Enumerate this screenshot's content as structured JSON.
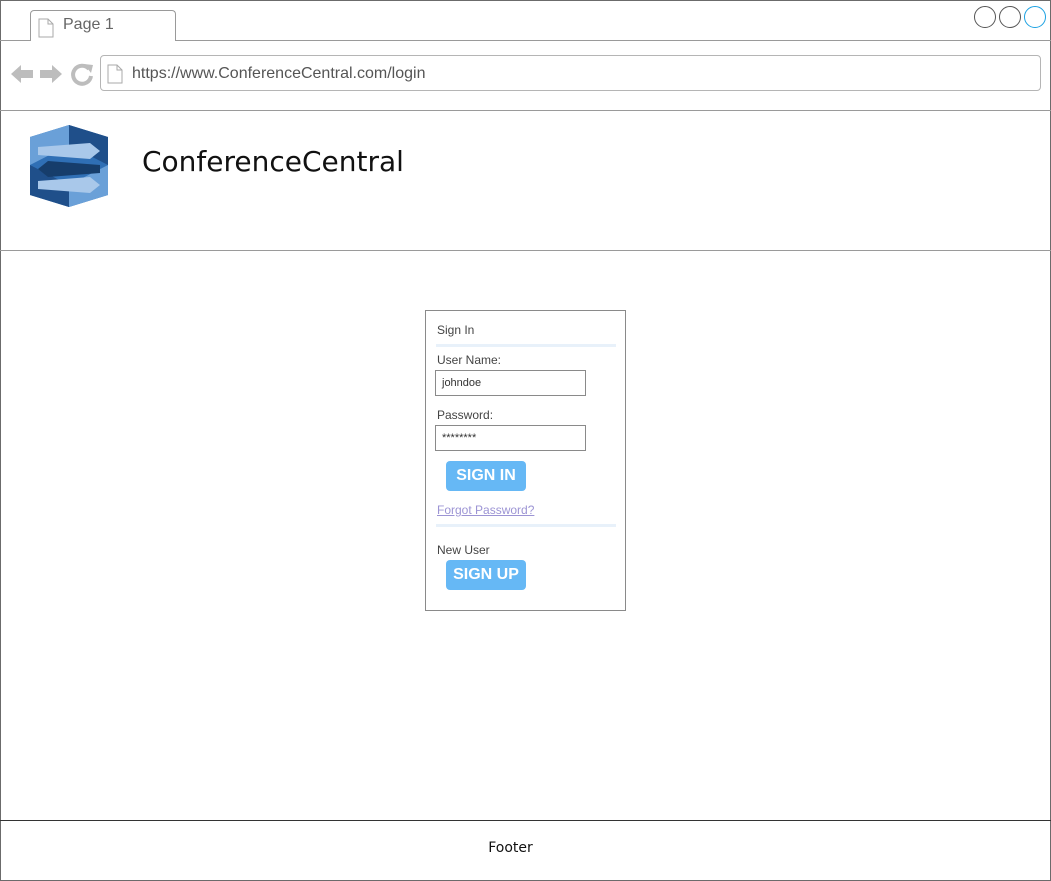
{
  "browser": {
    "tab_label": "Page 1",
    "url": "https://www.ConferenceCentral.com/login"
  },
  "header": {
    "site_title": "ConferenceCentral",
    "logo_icon": "hexagon-arrows-logo",
    "logo_colors": [
      "#1f4f8a",
      "#2f6fb5",
      "#6aa0d8",
      "#a9c8ea"
    ]
  },
  "login": {
    "title": "Sign In",
    "username_label": "User Name:",
    "username_value": "johndoe",
    "password_label": "Password:",
    "password_value": "********",
    "sign_in_label": "SIGN IN",
    "forgot_label": "Forgot Password?",
    "new_user_label": "New User",
    "sign_up_label": "SIGN UP",
    "button_color": "#66b8f5"
  },
  "footer": {
    "text": "Footer"
  }
}
